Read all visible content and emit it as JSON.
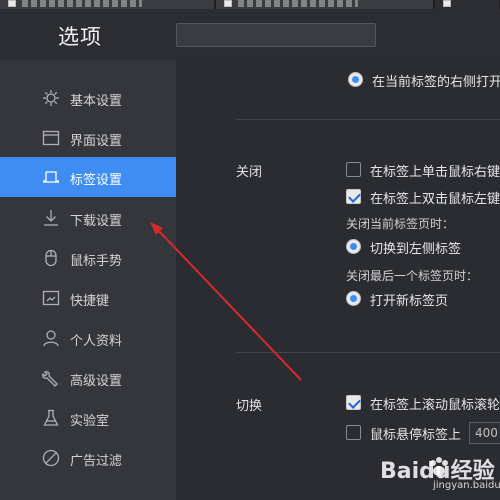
{
  "header": {
    "title": "选项",
    "search_placeholder": ""
  },
  "sidebar": {
    "items": [
      {
        "label": "基本设置",
        "icon": "gear-icon"
      },
      {
        "label": "界面设置",
        "icon": "window-icon"
      },
      {
        "label": "标签设置",
        "icon": "tab-icon",
        "active": true
      },
      {
        "label": "下载设置",
        "icon": "download-icon"
      },
      {
        "label": "鼠标手势",
        "icon": "mouse-icon"
      },
      {
        "label": "快捷键",
        "icon": "keyboard-icon"
      },
      {
        "label": "个人资料",
        "icon": "user-icon"
      },
      {
        "label": "高级设置",
        "icon": "wrench-icon"
      },
      {
        "label": "实验室",
        "icon": "flask-icon"
      },
      {
        "label": "广告过滤",
        "icon": "block-icon"
      }
    ]
  },
  "main": {
    "top_option": "在当前标签的右侧打开",
    "close": {
      "label": "关闭",
      "opt1": "在标签上单击鼠标右键",
      "opt2": "在标签上双击鼠标左键",
      "sub1": "关闭当前标签页时：",
      "sub1_choice": "切换到左侧标签",
      "sub2": "关闭最后一个标签页时：",
      "sub2_choice": "打开新标签页"
    },
    "switch": {
      "label": "切换",
      "opt1": "在标签上滚动鼠标滚轮",
      "opt2": "鼠标悬停标签上",
      "delay_value": "400"
    }
  },
  "watermark": {
    "brand": "Baidu经验",
    "url": "jingyan.baidu.com"
  },
  "colors": {
    "accent": "#3f8cf2",
    "sidebar_bg": "#35363c",
    "main_bg": "#2b2c31",
    "arrow": "#d42a2a"
  }
}
